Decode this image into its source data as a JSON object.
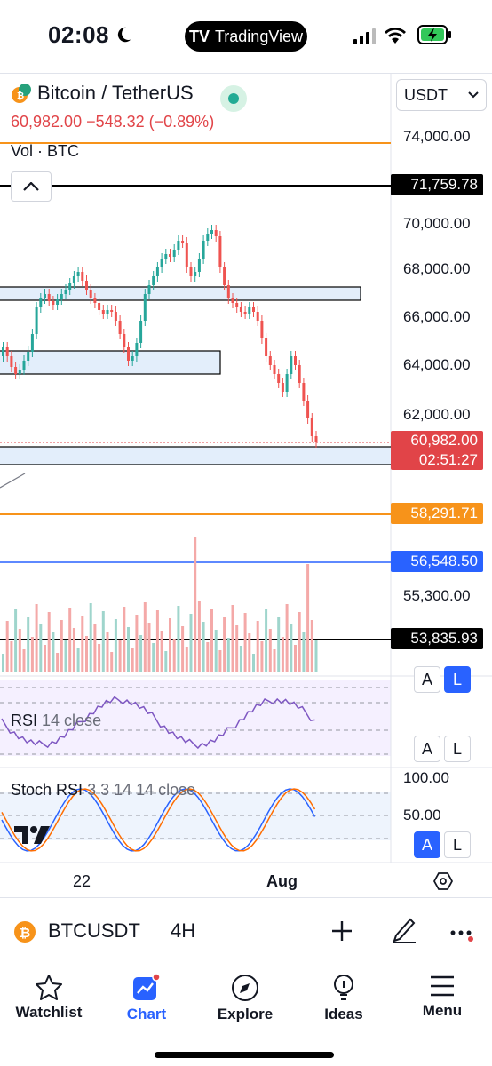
{
  "status_bar": {
    "time": "02:08",
    "app_pill": "TradingView"
  },
  "header": {
    "symbol_name": "Bitcoin / TetherUS",
    "price_line": "60,982.00  −548.32 (−0.89%)",
    "currency": "USDT",
    "volume_label": "Vol · BTC"
  },
  "price_axis": {
    "ticks": [
      "74,000.00",
      "70,000.00",
      "68,000.00",
      "66,000.00",
      "64,000.00",
      "62,000.00",
      "55,300.00"
    ],
    "tags": {
      "level_1": "71,759.78",
      "current_price": "60,982.00",
      "countdown": "02:51:27",
      "level_2": "58,291.71",
      "level_3": "56,548.50",
      "level_4": "53,835.93"
    }
  },
  "scale_buttons": {
    "auto": "A",
    "log": "L"
  },
  "rsi": {
    "name": "RSI",
    "params": "14 close"
  },
  "stoch_rsi": {
    "name": "Stoch RSI",
    "params": "3 3 14 14 close",
    "tick_high": "100.00",
    "tick_mid": "50.00"
  },
  "x_axis": {
    "tick_1": "22",
    "tick_2": "Aug"
  },
  "bottom_symbol": {
    "ticker": "BTCUSDT",
    "interval": "4H"
  },
  "nav": {
    "watchlist": "Watchlist",
    "chart": "Chart",
    "explore": "Explore",
    "ideas": "Ideas",
    "menu": "Menu"
  },
  "colors": {
    "up": "#26a69a",
    "down": "#ef5350",
    "accent": "#2962ff",
    "orange": "#f7931a"
  }
}
